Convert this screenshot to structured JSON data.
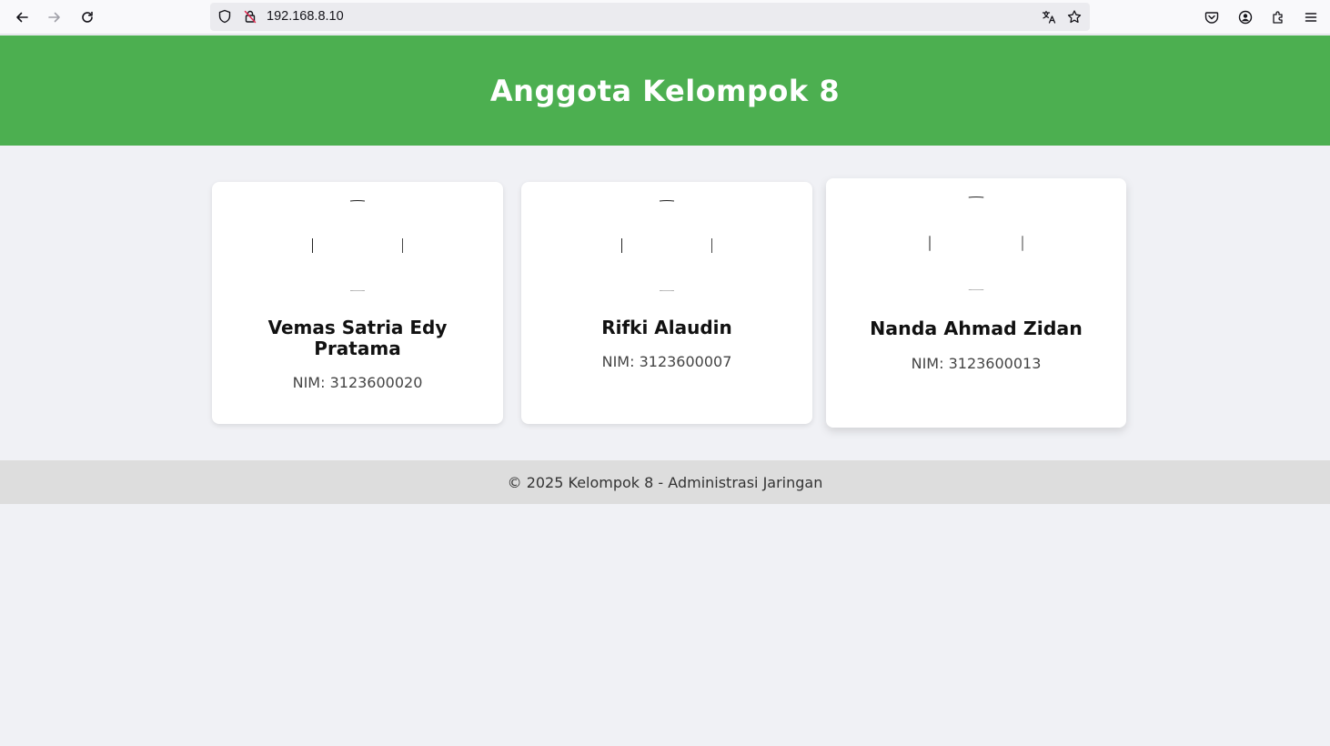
{
  "browser": {
    "url": "192.168.8.10"
  },
  "header": {
    "title": "Anggota Kelompok 8"
  },
  "members": [
    {
      "name": "Vemas Satria Edy Pratama",
      "nim": "NIM: 3123600020"
    },
    {
      "name": "Rifki Alaudin",
      "nim": "NIM: 3123600007"
    },
    {
      "name": "Nanda Ahmad Zidan",
      "nim": "NIM: 3123600013"
    }
  ],
  "footer": {
    "text": "© 2025 Kelompok 8 - Administrasi Jaringan"
  },
  "colors": {
    "header_bg": "#4caf50",
    "page_bg": "#f0f1f5",
    "footer_bg": "#dddddd"
  }
}
